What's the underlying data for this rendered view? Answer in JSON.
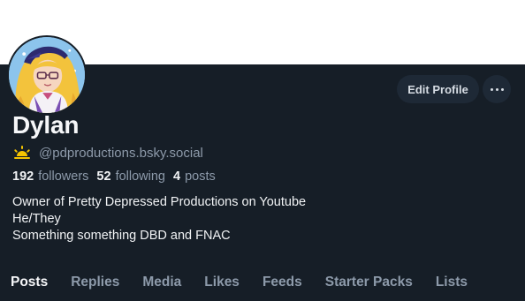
{
  "profile": {
    "display_name": "Dylan",
    "handle": "@pdproductions.bsky.social",
    "badge_icon": "sunrise-icon",
    "stats": {
      "followers_count": "192",
      "followers_label": "followers",
      "following_count": "52",
      "following_label": "following",
      "posts_count": "4",
      "posts_label": "posts"
    },
    "bio": [
      "Owner of Pretty Depressed Productions on Youtube",
      "He/They",
      "Something something DBD and FNAC"
    ]
  },
  "actions": {
    "edit_label": "Edit Profile",
    "more_icon": "ellipsis-icon"
  },
  "tabs": [
    "Posts",
    "Replies",
    "Media",
    "Likes",
    "Feeds",
    "Starter Packs",
    "Lists"
  ],
  "colors": {
    "background": "#161e27",
    "banner": "#ffffff",
    "button_bg": "#1e2936",
    "muted_text": "#8d9aaa",
    "badge": "#f5c400"
  }
}
